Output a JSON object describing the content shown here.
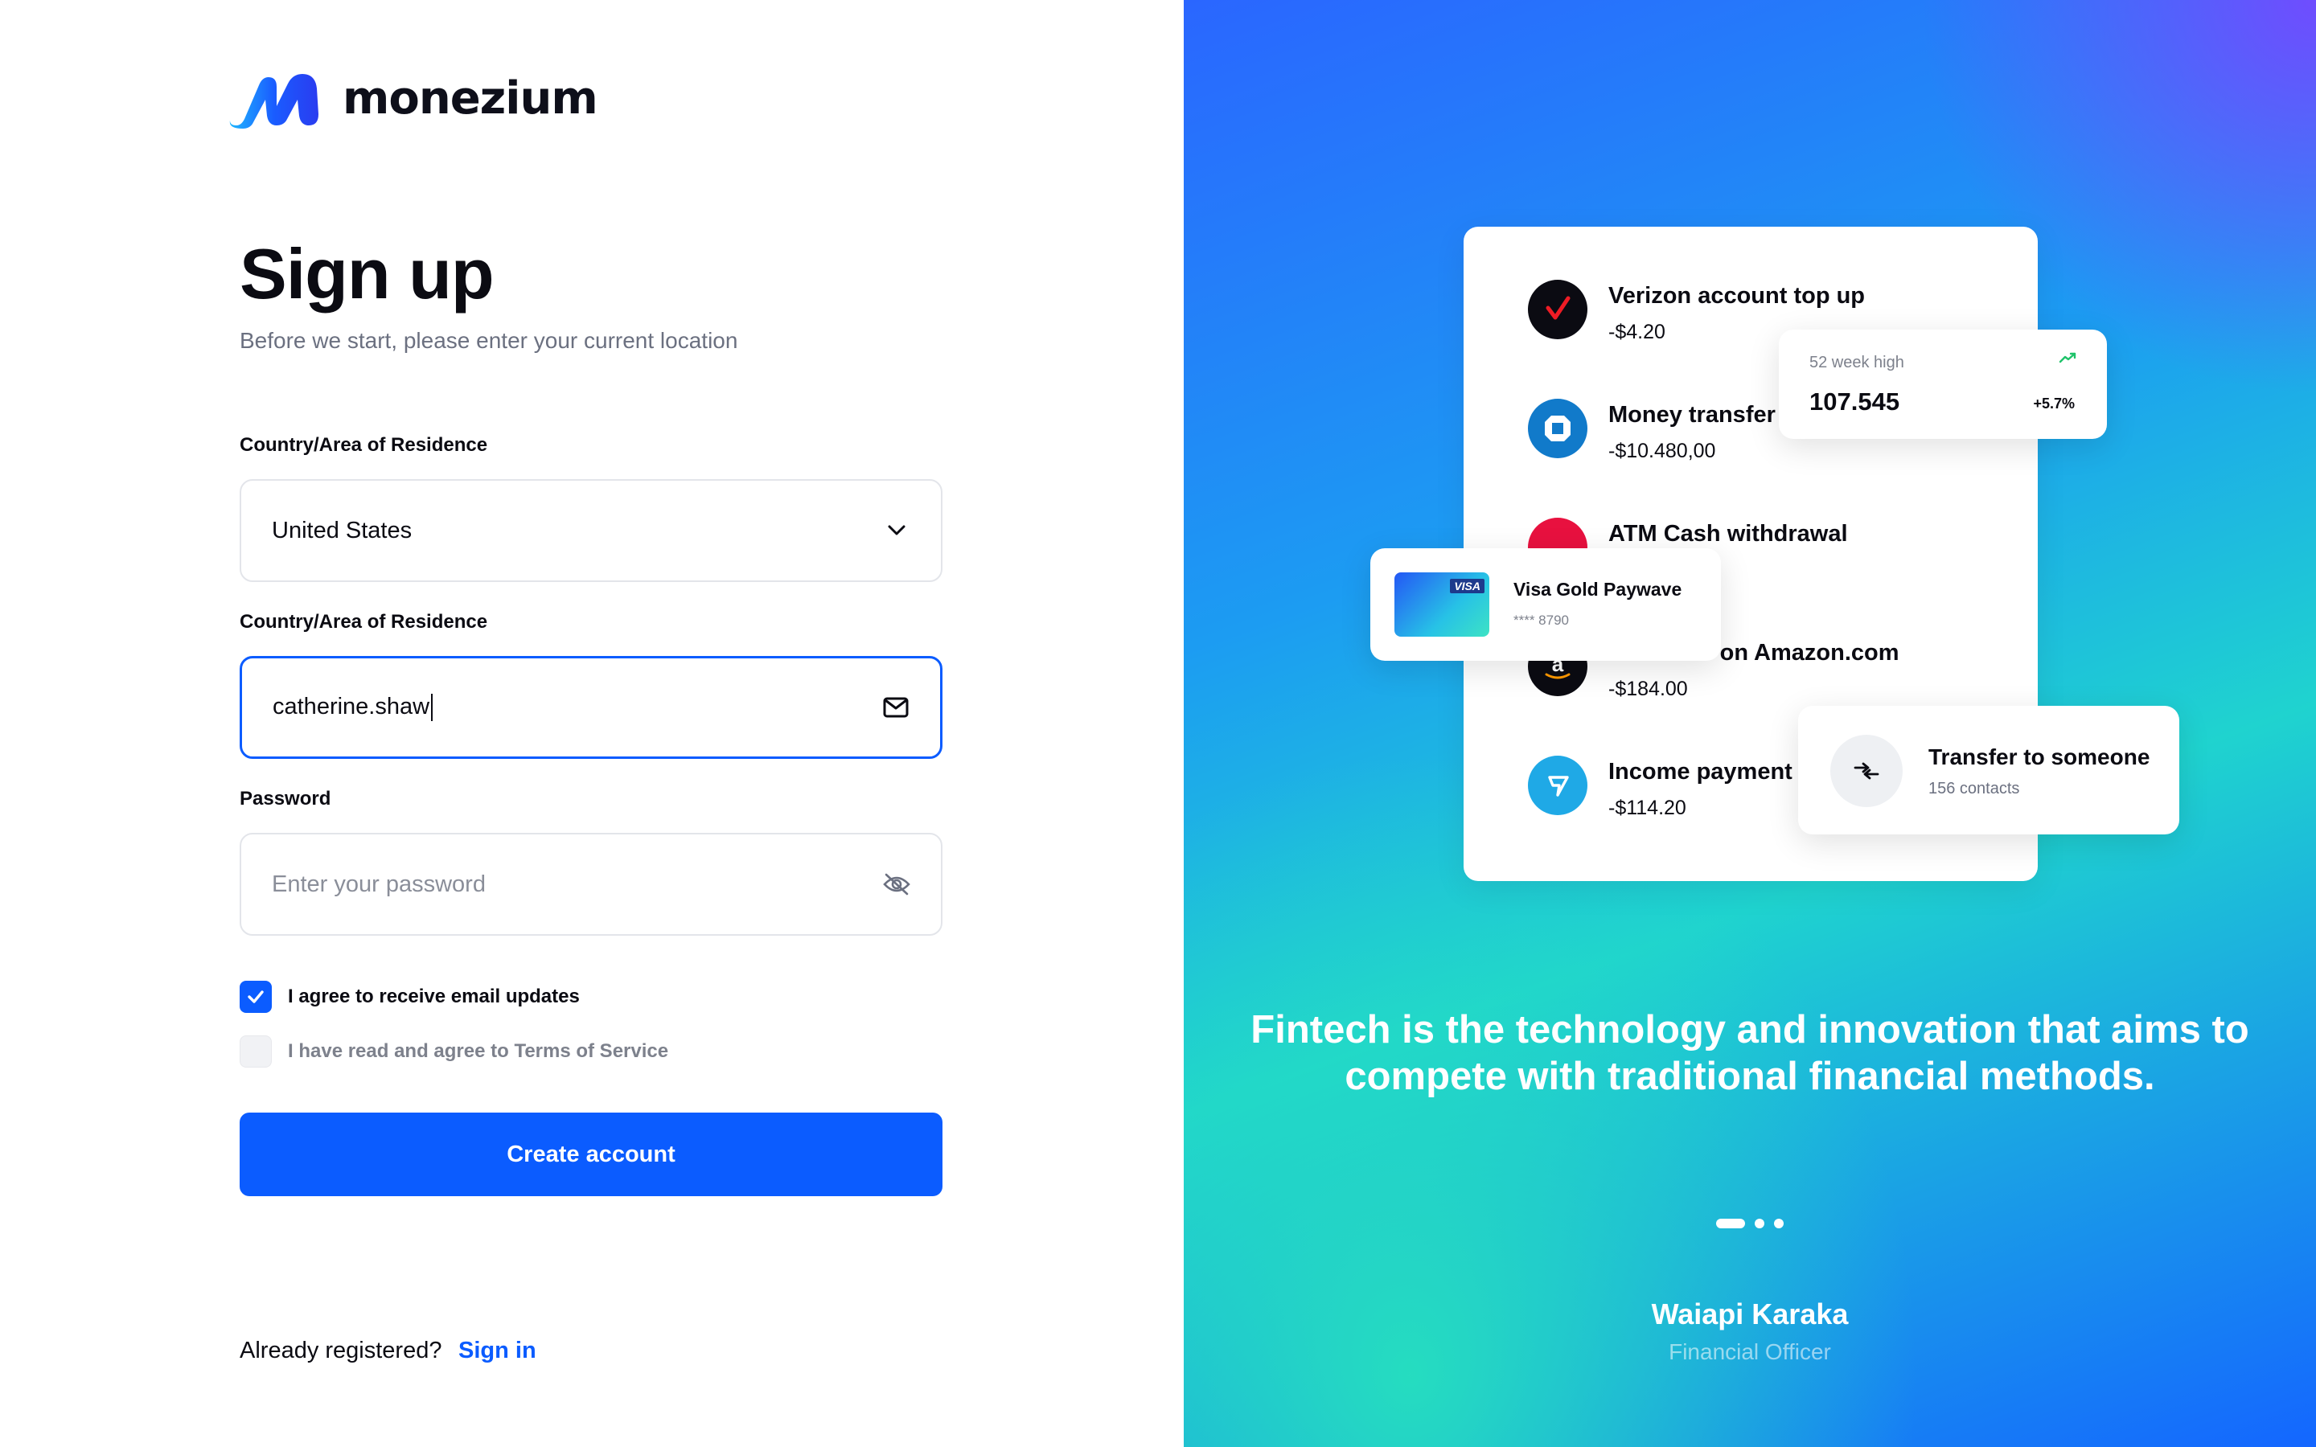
{
  "brand": {
    "name": "monezium"
  },
  "form": {
    "title": "Sign up",
    "subtitle": "Before we start, please enter your current location",
    "country": {
      "label": "Country/Area of Residence",
      "value": "United States"
    },
    "email": {
      "label": "Country/Area of Residence",
      "value": "catherine.shaw"
    },
    "password": {
      "label": "Password",
      "placeholder": "Enter your password"
    },
    "checkboxes": [
      {
        "label": "I agree to receive email updates",
        "checked": true
      },
      {
        "label": "I have read and agree to Terms of Service",
        "checked": false
      }
    ],
    "submit_label": "Create account",
    "already_text": "Already registered?",
    "signin_label": "Sign in"
  },
  "showcase": {
    "transactions": [
      {
        "name": "Verizon account top up",
        "amount": "-$4.20",
        "icon": "verizon-icon"
      },
      {
        "name": "Money transfer",
        "amount": "-$10.480,00",
        "icon": "chase-icon"
      },
      {
        "name": "ATM Cash withdrawal",
        "amount": "",
        "icon": "atm-icon"
      },
      {
        "name": "Purchase on Amazon.com",
        "amount": "-$184.00",
        "icon": "amazon-icon"
      },
      {
        "name": "Income payment",
        "amount": "-$114.20",
        "icon": "wise-icon"
      }
    ],
    "high_card": {
      "label": "52 week high",
      "value": "107.545",
      "change": "+5.7%"
    },
    "visa_card": {
      "name": "Visa Gold Paywave",
      "number": "**** 8790",
      "badge": "VISA"
    },
    "transfer_card": {
      "title": "Transfer to someone",
      "subtitle": "156 contacts"
    },
    "quote": "Fintech is the technology and innovation that aims to compete with traditional financial methods.",
    "author": {
      "name": "Waiapi Karaka",
      "role": "Financial Officer"
    },
    "colors": {
      "accent": "#0b5cff",
      "verizon": "#ee1c25",
      "chase": "#117aca",
      "wise": "#1fa9e6"
    }
  }
}
